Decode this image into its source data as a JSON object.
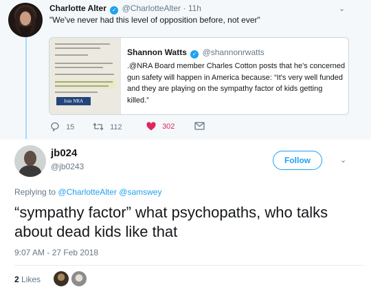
{
  "parent_tweet": {
    "author_name": "Charlotte Alter",
    "handle": "@CharlotteAlter",
    "time": "· 11h",
    "text": "\"We've never had this level of opposition before, not ever\"",
    "quoted_tweet": {
      "author_name": "Shannon Watts",
      "handle": "@shannonrwatts",
      "text": ".@NRA Board member Charles Cotton posts that he's concerned gun safety will happen in America because: “It's very well funded and they are playing on the sympathy factor of kids getting killed.”",
      "thumbnail_label": "Join NRA"
    },
    "actions": {
      "replies": "15",
      "retweets": "112",
      "likes": "302"
    }
  },
  "main_tweet": {
    "author_name": "jb024",
    "handle": "@jb0243",
    "follow_label": "Follow",
    "replying_prefix": "Replying to",
    "replying_to": "@CharlotteAlter @samswey",
    "text": "“sympathy factor” what psychopaths, who talks about dead kids like that",
    "timestamp": "9:07 AM - 27 Feb 2018",
    "likes_count": "2",
    "likes_label": "Likes"
  },
  "colors": {
    "accent": "#1da1f2",
    "like": "#e0245e",
    "muted_text": "#657786",
    "thread_line": "#a9d8f7",
    "parent_background": "#f5f8fa"
  },
  "icons": [
    "verified-badge-icon",
    "chevron-down-icon",
    "reply-icon",
    "retweet-icon",
    "heart-icon",
    "direct-message-icon"
  ]
}
